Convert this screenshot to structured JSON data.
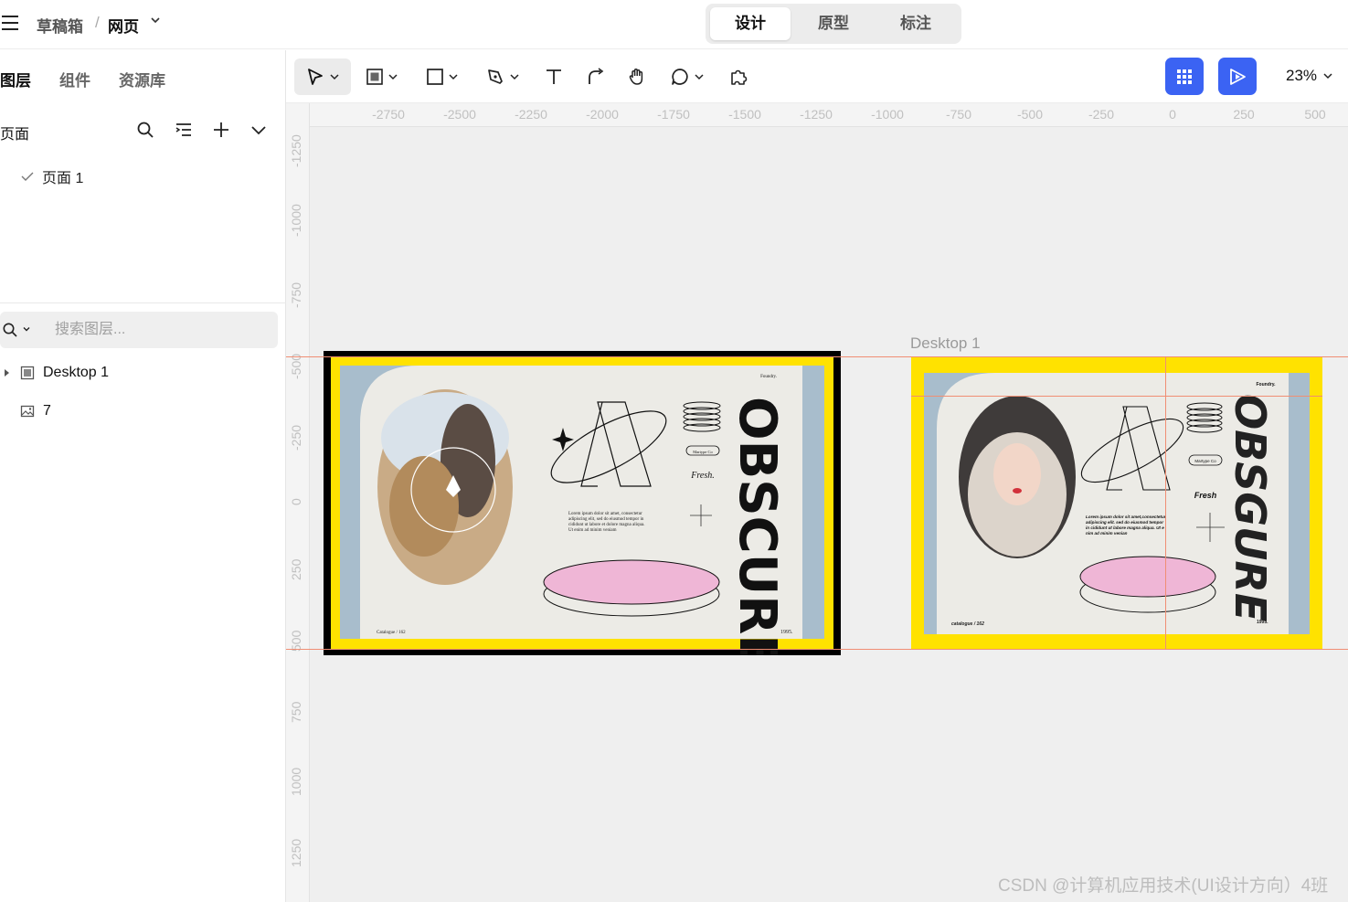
{
  "header": {
    "menu_icon": "hamburger-icon",
    "breadcrumb_drafts": "草稿箱",
    "breadcrumb_sep": "/",
    "breadcrumb_file": "网页",
    "modes": [
      "设计",
      "原型",
      "标注"
    ],
    "active_mode": "设计"
  },
  "left_panel": {
    "tabs": [
      "图层",
      "组件",
      "资源库"
    ],
    "pages_title": "页面",
    "pages": [
      {
        "label": "页面 1",
        "checked": true
      }
    ],
    "search_placeholder": "搜索图层...",
    "layers": [
      {
        "label": "Desktop 1",
        "icon": "frame-icon",
        "collapsed": true
      },
      {
        "label": "7",
        "icon": "image-icon"
      }
    ]
  },
  "toolbar": {
    "tools": [
      "move-tool",
      "frame-tool",
      "rectangle-tool",
      "pen-tool",
      "text-tool",
      "connector-tool",
      "hand-tool",
      "comment-tool",
      "plugin-tool"
    ],
    "zoom": "23%",
    "accent": "#3b63f3"
  },
  "canvas": {
    "ruler_x": [
      "-2750",
      "-2500",
      "-2250",
      "-2000",
      "-1750",
      "-1500",
      "-1250",
      "-1000",
      "-750",
      "-500",
      "-250",
      "0",
      "250",
      "500"
    ],
    "ruler_y": [
      "-1250",
      "-1000",
      "-750",
      "-500",
      "-250",
      "0",
      "250",
      "500",
      "750",
      "1000",
      "1250"
    ],
    "frame_label": "Desktop 1",
    "guide_color": "#f08e74",
    "artwork": {
      "left": {
        "brand": "Foundry.",
        "stamp_text": "MARTYRE.CO  FOUNDRY",
        "pill_text": "Martype Co",
        "fresh": "Fresh.",
        "lorem": [
          "Lorem ipsum dolor sit amet, consectetur",
          "adipiscing elit, sed do eiusmod tempor in",
          "cididunt ut labore et dolore magna aliqua.",
          "Ut enim ad minim veniam"
        ],
        "catalogue": "Catalogue / 162",
        "year": "1995.",
        "title": "OBSCURE"
      },
      "right": {
        "brand": "Foundry.",
        "pill_text": "Martype Co",
        "fresh": "Fresh",
        "lorem": [
          "Lorem ipsum dolor sit amet,consectetur",
          "adipiscing elit. sed do eiusmod  tempor",
          "in cididunt ut labore magna aliqua. Ut e",
          "nim ad minim venian"
        ],
        "catalogue": "catalogue / 162",
        "year": "1995.",
        "title": "OBSGURE"
      },
      "colors": {
        "yellow": "#ffe200",
        "paper": "#ecebe6",
        "blue": "#a8bdcc",
        "pink": "#efb6d6",
        "ink": "#111111"
      }
    },
    "watermark": "CSDN @计算机应用技术(UI设计方向）4班"
  }
}
